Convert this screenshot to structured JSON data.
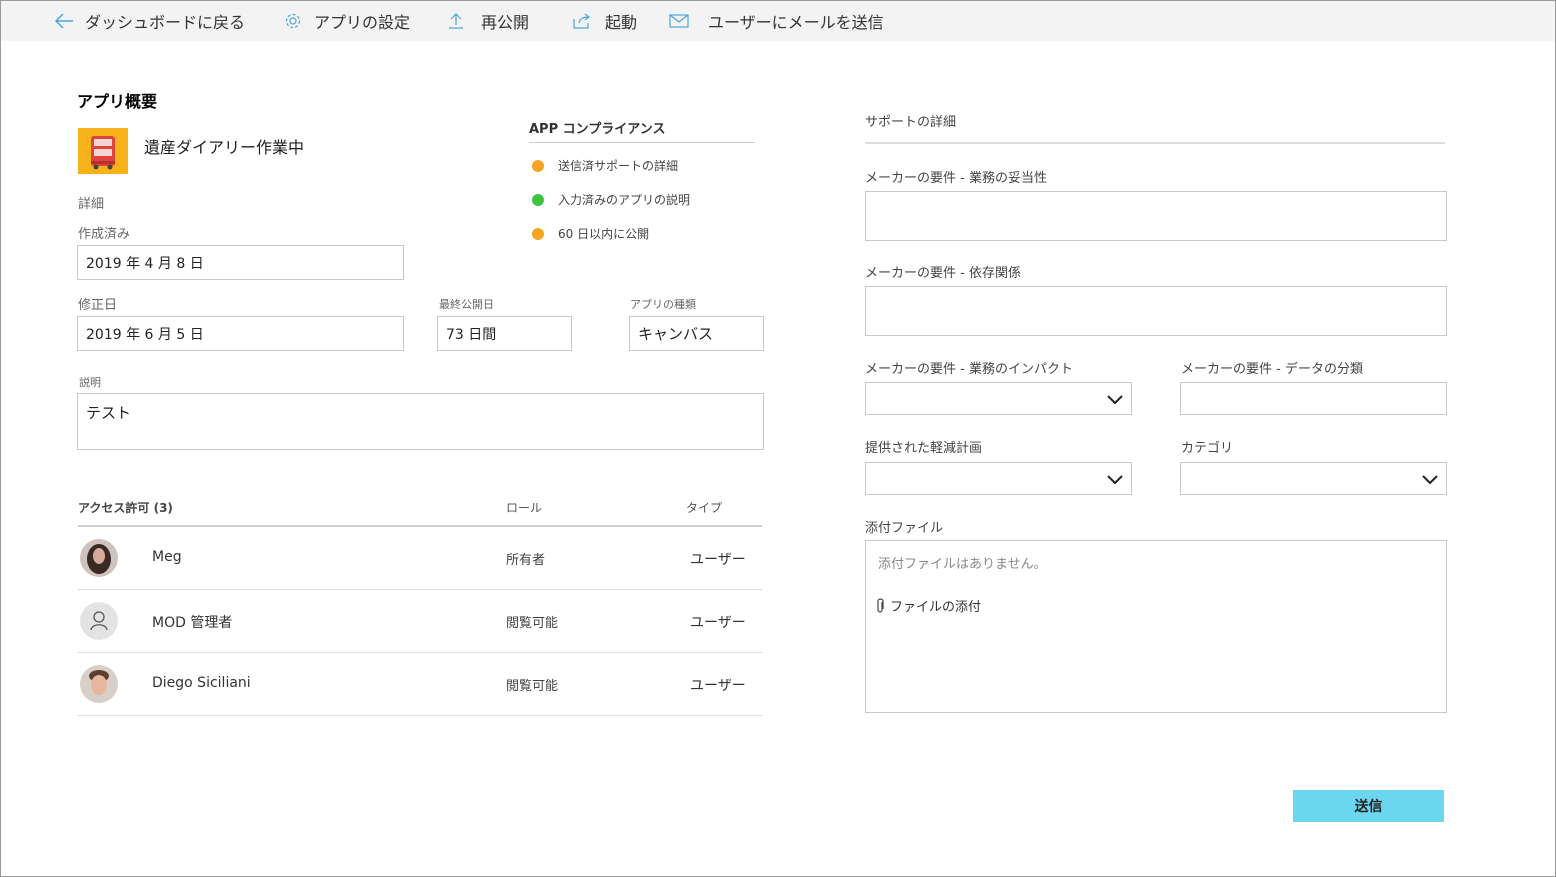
{
  "toolbar": {
    "back": "ダッシュボードに戻る",
    "settings": "アプリの設定",
    "republish": "再公開",
    "launch": "起動",
    "email": "ユーザーにメールを送信"
  },
  "overview": {
    "title": "アプリ概要",
    "app_name": "遺産ダイアリー作業中",
    "details_label": "詳細",
    "created_label": "作成済み",
    "created_value": "2019 年 4 月 8 日",
    "modified_label": "修正日",
    "modified_value": "2019 年 6 月 5 日",
    "last_published_label": "最終公開日",
    "last_published_value": "73 日間",
    "app_type_label": "アプリの種類",
    "app_type_value": "キャンバス",
    "description_label": "説明",
    "description_value": "テスト"
  },
  "compliance": {
    "title": "APP コンプライアンス",
    "items": [
      {
        "label": "送信済サポートの詳細",
        "color": "#f5a623"
      },
      {
        "label": "入力済みのアプリの説明",
        "color": "#3cc43c"
      },
      {
        "label": "60 日以内に公開",
        "color": "#f5a623"
      }
    ]
  },
  "permissions": {
    "header": "アクセス許可 (3)",
    "role_header": "ロール",
    "type_header": "タイプ",
    "rows": [
      {
        "name": "Meg",
        "role": "所有者",
        "type": "ユーザー",
        "avatar": "photo"
      },
      {
        "name": "MOD 管理者",
        "role": "閲覧可能",
        "type": "ユーザー",
        "avatar": "person-icon"
      },
      {
        "name": "Diego Siciliani",
        "role": "閲覧可能",
        "type": "ユーザー",
        "avatar": "photo"
      }
    ]
  },
  "support": {
    "title": "サポートの詳細",
    "business_justification_label": "メーカーの要件 - 業務の妥当性",
    "business_justification_value": "",
    "dependencies_label": "メーカーの要件 - 依存関係",
    "dependencies_value": "",
    "business_impact_label": "メーカーの要件 - 業務のインパクト",
    "data_classification_label": "メーカーの要件 - データの分類",
    "mitigation_label": "提供された軽減計画",
    "category_label": "カテゴリ",
    "attachments_label": "添付ファイル",
    "attachments_empty": "添付ファイルはありません。",
    "attach_link": "ファイルの添付",
    "submit": "送信"
  },
  "colors": {
    "accent": "#6ad7ef",
    "toolbar_icon": "#4aa8d8",
    "app_icon_bg": "#f7b21a"
  }
}
